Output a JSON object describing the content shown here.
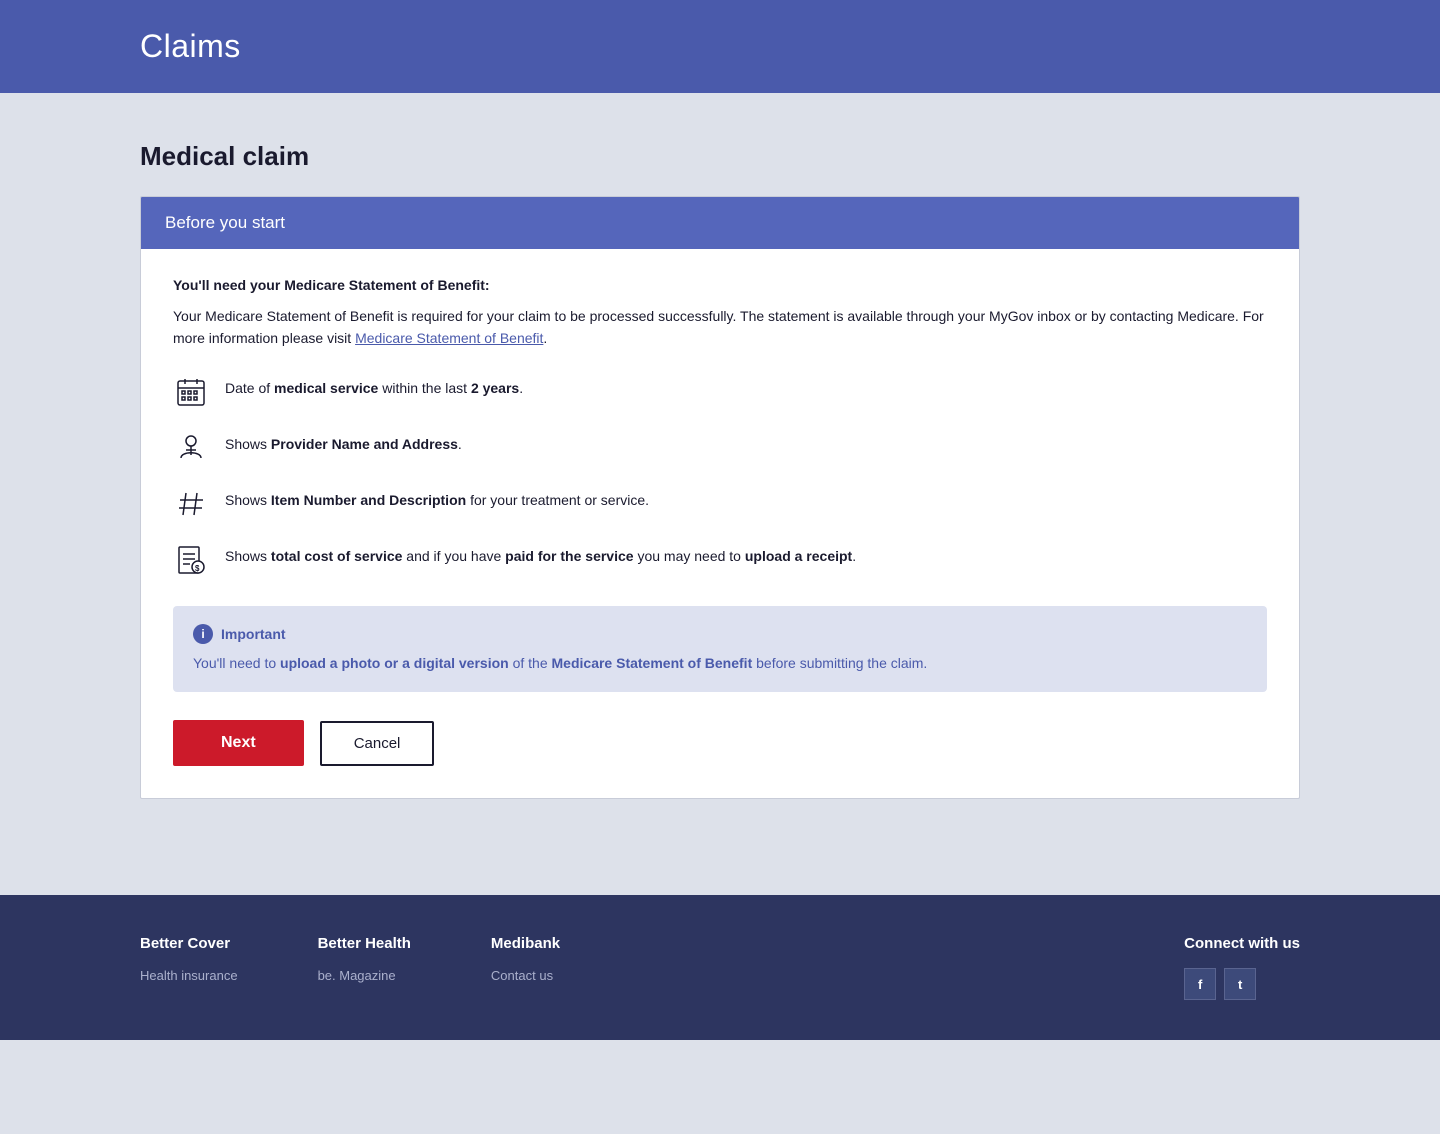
{
  "header": {
    "title": "Claims"
  },
  "page": {
    "title": "Medical claim"
  },
  "card": {
    "header_title": "Before you start",
    "statement_title": "You'll need your Medicare Statement of Benefit:",
    "statement_desc_start": "Your Medicare Statement of Benefit is required for your claim to be processed successfully. The statement is available through your MyGov inbox or by contacting Medicare. For more information please visit ",
    "statement_link_text": "Medicare Statement of Benefit",
    "statement_desc_end": ".",
    "requirements": [
      {
        "icon": "calendar-icon",
        "text_start": "Date of ",
        "text_bold": "medical service",
        "text_end": " within the last ",
        "text_bold2": "2 years",
        "text_end2": "."
      },
      {
        "icon": "person-icon",
        "text_start": "Shows ",
        "text_bold": "Provider Name and Address",
        "text_end": "."
      },
      {
        "icon": "hash-icon",
        "text_start": "Shows ",
        "text_bold": "Item Number and Description",
        "text_end": " for your treatment or service."
      },
      {
        "icon": "receipt-icon",
        "text_start": "Shows ",
        "text_bold": "total cost of service",
        "text_end": " and if you have ",
        "text_bold2": "paid for the service",
        "text_end2": " you may need to ",
        "text_bold3": "upload a receipt",
        "text_end3": "."
      }
    ],
    "important": {
      "label": "Important",
      "text_start": "You'll need to ",
      "text_bold1": "upload a photo or a digital version",
      "text_mid": " of the ",
      "text_bold2": "Medicare Statement of Benefit",
      "text_end": " before submitting the claim."
    },
    "buttons": {
      "next_label": "Next",
      "cancel_label": "Cancel"
    }
  },
  "footer": {
    "columns": [
      {
        "id": "better-cover",
        "title": "Better Cover",
        "link": "Health insurance"
      },
      {
        "id": "better-health",
        "title": "Better Health",
        "link": "be. Magazine"
      },
      {
        "id": "medibank",
        "title": "Medibank",
        "link": "Contact us"
      },
      {
        "id": "connect",
        "title": "Connect with us"
      }
    ],
    "social": [
      {
        "icon": "facebook-icon",
        "label": "f"
      },
      {
        "icon": "twitter-icon",
        "label": "t"
      }
    ]
  }
}
